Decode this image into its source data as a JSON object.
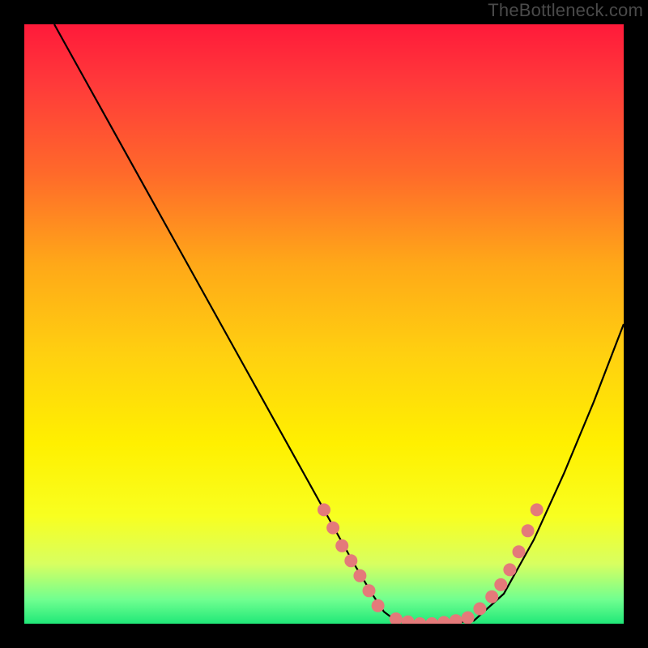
{
  "watermark": "TheBottleneck.com",
  "chart_data": {
    "type": "line",
    "title": "",
    "xlabel": "",
    "ylabel": "",
    "xlim": [
      0,
      100
    ],
    "ylim": [
      0,
      100
    ],
    "grid": false,
    "legend": false,
    "series": [
      {
        "name": "curve",
        "x": [
          5,
          10,
          15,
          20,
          25,
          30,
          35,
          40,
          45,
          50,
          55,
          58,
          60,
          62,
          65,
          70,
          75,
          80,
          85,
          90,
          95,
          100
        ],
        "values": [
          100,
          91,
          82,
          73,
          64,
          55,
          46,
          37,
          28,
          19,
          10,
          5,
          2,
          0.5,
          0,
          0,
          0.5,
          5,
          14,
          25,
          37,
          50
        ]
      }
    ],
    "markers": [
      {
        "x": 50.0,
        "y": 19.0
      },
      {
        "x": 51.5,
        "y": 16.0
      },
      {
        "x": 53.0,
        "y": 13.0
      },
      {
        "x": 54.5,
        "y": 10.5
      },
      {
        "x": 56.0,
        "y": 8.0
      },
      {
        "x": 57.5,
        "y": 5.5
      },
      {
        "x": 59.0,
        "y": 3.0
      },
      {
        "x": 62.0,
        "y": 0.8
      },
      {
        "x": 64.0,
        "y": 0.3
      },
      {
        "x": 66.0,
        "y": 0.0
      },
      {
        "x": 68.0,
        "y": 0.0
      },
      {
        "x": 70.0,
        "y": 0.2
      },
      {
        "x": 72.0,
        "y": 0.5
      },
      {
        "x": 74.0,
        "y": 1.0
      },
      {
        "x": 76.0,
        "y": 2.5
      },
      {
        "x": 78.0,
        "y": 4.5
      },
      {
        "x": 79.5,
        "y": 6.5
      },
      {
        "x": 81.0,
        "y": 9.0
      },
      {
        "x": 82.5,
        "y": 12.0
      },
      {
        "x": 84.0,
        "y": 15.5
      },
      {
        "x": 85.5,
        "y": 19.0
      }
    ]
  }
}
